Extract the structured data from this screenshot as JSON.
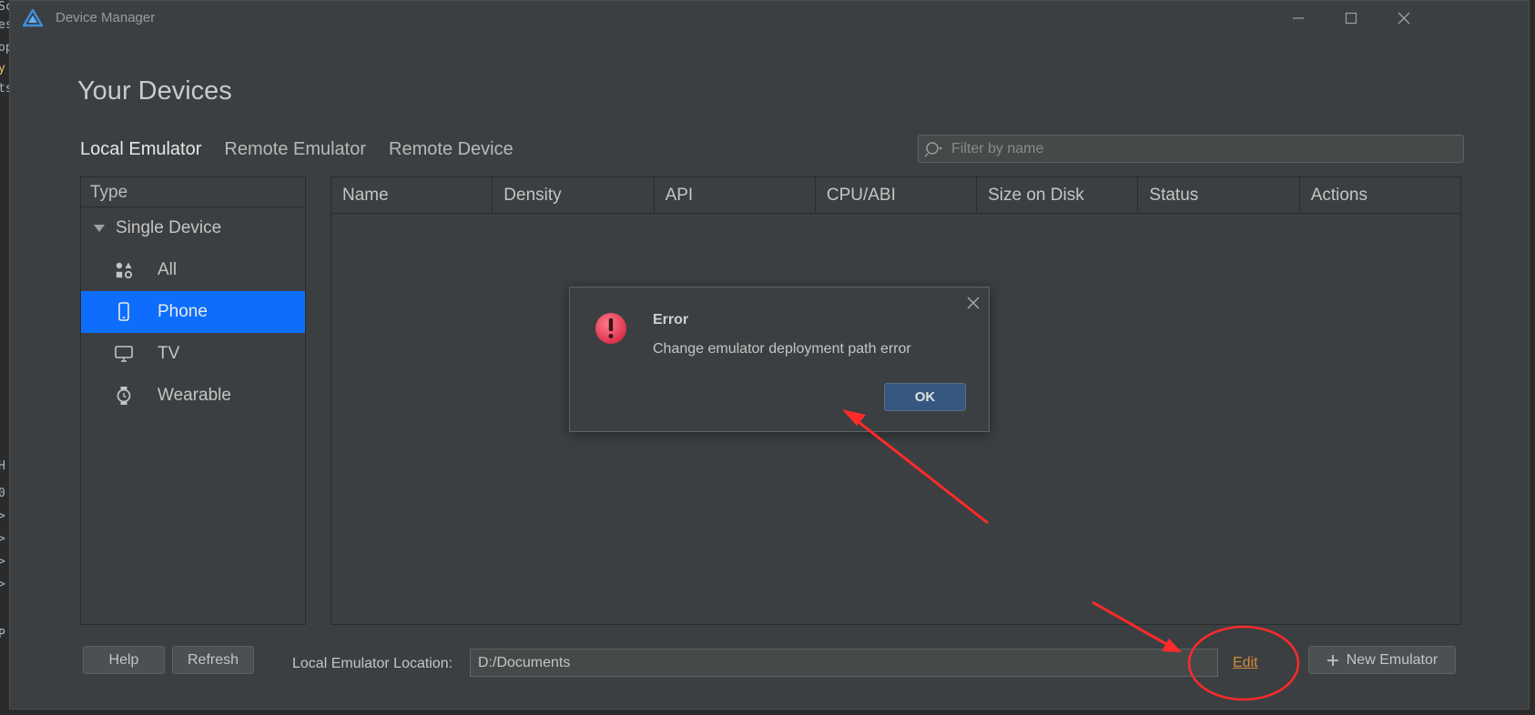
{
  "window": {
    "title": "Device Manager",
    "minimize_icon": "minimize-icon",
    "maximize_icon": "maximize-icon",
    "close_icon": "close-icon"
  },
  "page": {
    "title": "Your Devices"
  },
  "tabs": [
    {
      "label": "Local Emulator",
      "active": true
    },
    {
      "label": "Remote Emulator",
      "active": false
    },
    {
      "label": "Remote Device",
      "active": false
    }
  ],
  "filter": {
    "placeholder": "Filter by name",
    "value": ""
  },
  "type_panel": {
    "header": "Type",
    "group": "Single Device",
    "items": [
      {
        "label": "All",
        "icon": "grid-shapes-icon",
        "selected": false
      },
      {
        "label": "Phone",
        "icon": "phone-icon",
        "selected": true
      },
      {
        "label": "TV",
        "icon": "tv-icon",
        "selected": false
      },
      {
        "label": "Wearable",
        "icon": "watch-icon",
        "selected": false
      }
    ]
  },
  "table": {
    "columns": [
      "Name",
      "Density",
      "API",
      "CPU/ABI",
      "Size on Disk",
      "Status",
      "Actions"
    ],
    "rows": []
  },
  "bottom": {
    "help_label": "Help",
    "refresh_label": "Refresh",
    "location_label": "Local Emulator Location:",
    "location_value": "D:/Documents",
    "edit_label": "Edit",
    "new_emulator_label": "New Emulator"
  },
  "dialog": {
    "title": "Error",
    "message": "Change emulator deployment path error",
    "ok_label": "OK"
  },
  "colors": {
    "accent": "#0d6efd",
    "background": "#3c3f41",
    "annotation": "#ff2a2a",
    "link": "#d18a3c"
  }
}
